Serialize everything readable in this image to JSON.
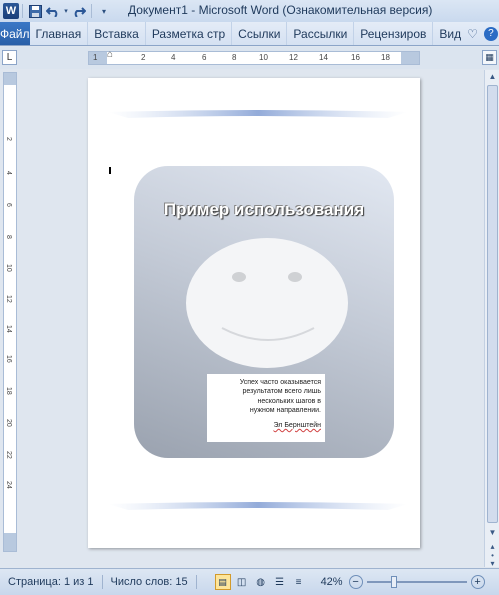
{
  "window": {
    "title": "Документ1  -  Microsoft Word (Ознакомительная версия)"
  },
  "quick_access": {
    "save_icon": "save-icon",
    "undo_icon": "undo-icon",
    "redo_icon": "redo-icon"
  },
  "ribbon": {
    "file_tab": "Файл",
    "tabs": [
      "Главная",
      "Вставка",
      "Разметка стр",
      "Ссылки",
      "Рассылки",
      "Рецензиров",
      "Вид"
    ]
  },
  "ruler": {
    "corner": "L",
    "h_ticks": [
      "1",
      "2",
      "4",
      "6",
      "8",
      "10",
      "12",
      "14",
      "16",
      "18"
    ],
    "v_ticks": [
      "2",
      "4",
      "6",
      "8",
      "10",
      "12",
      "14",
      "16",
      "18",
      "20",
      "22",
      "24"
    ]
  },
  "document": {
    "card_title": "Пример использования",
    "quote_lines": [
      "Успех часто оказывается",
      "результатом всего лишь",
      "нескольких шагов в",
      "нужном направлении."
    ],
    "quote_author": "Эл Бернштейн"
  },
  "status": {
    "page": "Страница: 1 из 1",
    "words": "Число слов: 15",
    "zoom": "42%",
    "zoom_minus": "−",
    "zoom_plus": "+"
  },
  "colors": {
    "file_tab": "#2a5fa8",
    "ribbon_bg": "#d5e1f2",
    "card_gradient_dark": "#9aa2af",
    "card_gradient_light": "#e2e8f2"
  }
}
